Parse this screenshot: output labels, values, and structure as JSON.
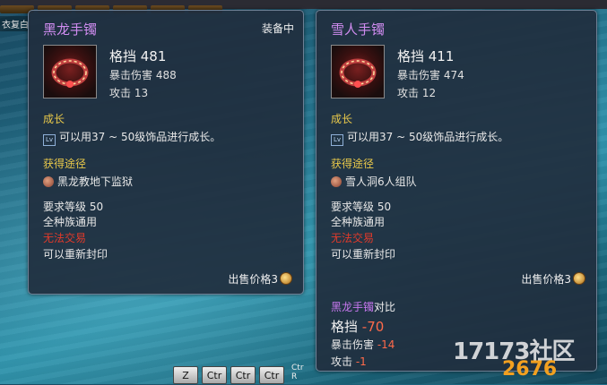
{
  "background": {
    "side_label": "衣复白"
  },
  "left_card": {
    "name": "黑龙手镯",
    "equipped": "装备中",
    "stat_main": "格挡 481",
    "stat_crit": "暴击伤害 488",
    "stat_atk": "攻击 13",
    "growth_title": "成长",
    "growth_text": "可以用37 ~ 50级饰品进行成长。",
    "route_title": "获得途径",
    "route_text": "黑龙教地下监狱",
    "level_req": "要求等级 50",
    "race": "全种族通用",
    "trade": "无法交易",
    "reseal": "可以重新封印",
    "sell_price": "出售价格3"
  },
  "right_card": {
    "name": "雪人手镯",
    "stat_main": "格挡 411",
    "stat_crit": "暴击伤害 474",
    "stat_atk": "攻击 12",
    "growth_title": "成长",
    "growth_text": "可以用37 ~ 50级饰品进行成长。",
    "route_title": "获得途径",
    "route_text": "雪人洞6人组队",
    "level_req": "要求等级 50",
    "race": "全种族通用",
    "trade": "无法交易",
    "reseal": "可以重新封印",
    "sell_price": "出售价格3",
    "compare": {
      "item": "黑龙手镯",
      "suffix": "对比",
      "block_label": "格挡",
      "block_diff": "-70",
      "crit_label": "暴击伤害",
      "crit_diff": "-14",
      "atk_label": "攻击",
      "atk_diff": "-1"
    }
  },
  "hotkeys": {
    "k1": "Z",
    "k2": "Ctr",
    "k3": "Ctr",
    "k4": "Ctr",
    "label": "Ctr R"
  },
  "watermark": {
    "text1": "17173社区",
    "text2": "2676"
  },
  "colors": {
    "item_name": "#d08cf0",
    "section": "#e8c84a",
    "untradable": "#e23a2a",
    "diff": "#ff6a4a"
  }
}
